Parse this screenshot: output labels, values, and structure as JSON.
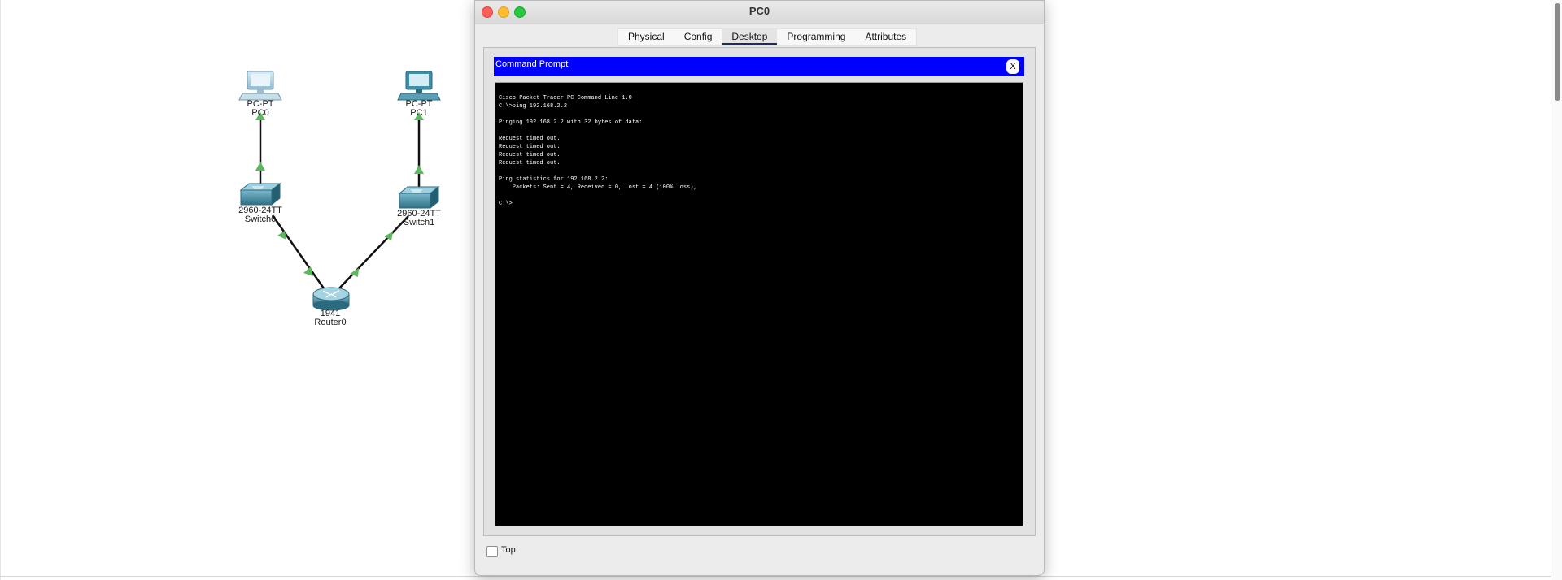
{
  "window": {
    "title": "PC0",
    "tabs": [
      {
        "label": "Physical",
        "active": false
      },
      {
        "label": "Config",
        "active": false
      },
      {
        "label": "Desktop",
        "active": true
      },
      {
        "label": "Programming",
        "active": false
      },
      {
        "label": "Attributes",
        "active": false
      }
    ],
    "top_checkbox_label": "Top",
    "top_checkbox_checked": false
  },
  "command_prompt": {
    "title": "Command Prompt",
    "close_label": "X",
    "output": [
      "Cisco Packet Tracer PC Command Line 1.0",
      "C:\\>ping 192.168.2.2",
      "",
      "Pinging 192.168.2.2 with 32 bytes of data:",
      "",
      "Request timed out.",
      "Request timed out.",
      "Request timed out.",
      "Request timed out.",
      "",
      "Ping statistics for 192.168.2.2:",
      "    Packets: Sent = 4, Received = 0, Lost = 4 (100% loss),",
      "",
      "C:\\>"
    ]
  },
  "topology": {
    "devices": [
      {
        "id": "pc0",
        "model": "PC-PT",
        "name": "PC0"
      },
      {
        "id": "pc1",
        "model": "PC-PT",
        "name": "PC1"
      },
      {
        "id": "switch0",
        "model": "2960-24TT",
        "name": "Switch0"
      },
      {
        "id": "switch1",
        "model": "2960-24TT",
        "name": "Switch1"
      },
      {
        "id": "router0",
        "model": "1941",
        "name": "Router0"
      }
    ],
    "link_status_color": "#5cb85c"
  },
  "colors": {
    "cmd_header": "#0000ff",
    "terminal_bg": "#000000",
    "terminal_text": "#ffffff",
    "device_body": "#3f8fa6"
  }
}
